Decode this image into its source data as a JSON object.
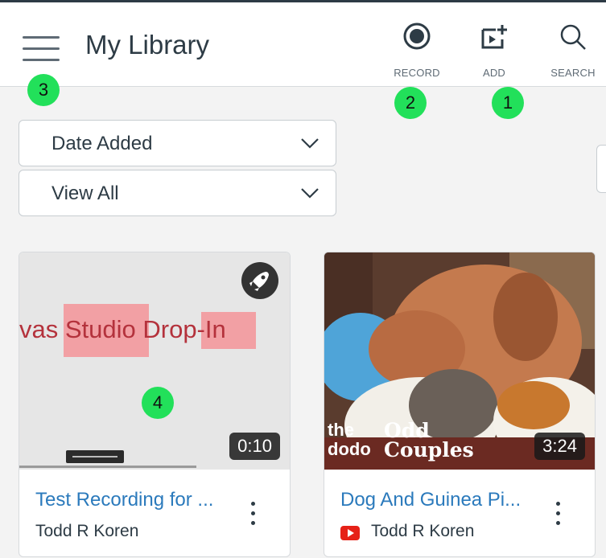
{
  "header": {
    "title": "My Library",
    "tools": [
      {
        "label": "RECORD",
        "icon": "record-icon"
      },
      {
        "label": "ADD",
        "icon": "add-media-icon"
      },
      {
        "label": "SEARCH",
        "icon": "search-icon"
      }
    ]
  },
  "filters": {
    "sort": {
      "value": "Date Added",
      "icon": "chevron-down-icon"
    },
    "view": {
      "value": "View All",
      "icon": "chevron-down-icon"
    }
  },
  "badges": [
    "1",
    "2",
    "3",
    "4"
  ],
  "cards": [
    {
      "title": "Test Recording for ...",
      "owner": "Todd R Koren",
      "duration": "0:10",
      "thumb_text": "vas Studio Drop-In",
      "icons": [
        "rocket-icon",
        "more-vertical-icon"
      ]
    },
    {
      "title": "Dog And Guinea Pi...",
      "owner": "Todd R Koren",
      "duration": "3:24",
      "thumb_text_line1": "the",
      "thumb_text_line2": "dodo",
      "thumb_text_overlay": "Odd Couples",
      "icons": [
        "youtube-icon",
        "more-vertical-icon"
      ]
    }
  ],
  "colors": {
    "accent_link": "#2b7abc",
    "badge": "#22e05a",
    "youtube": "#e62117"
  }
}
